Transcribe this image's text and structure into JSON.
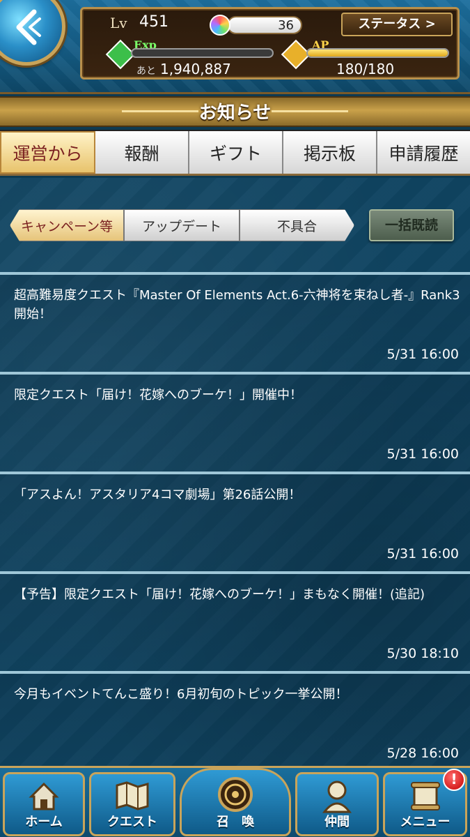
{
  "header": {
    "level_label": "Lv",
    "level": "451",
    "stones": "36",
    "status_button": "ステータス >",
    "exp_label": "Exp",
    "exp_remaining_label": "あと",
    "exp_remaining": "1,940,887",
    "exp_progress": 0.0,
    "ap_label": "AP",
    "ap_value": "180/180",
    "ap_progress": 1.0
  },
  "page": {
    "title": "お知らせ"
  },
  "main_tabs": [
    {
      "label": "運営から",
      "active": true
    },
    {
      "label": "報酬",
      "active": false
    },
    {
      "label": "ギフト",
      "active": false
    },
    {
      "label": "掲示板",
      "active": false
    },
    {
      "label": "申請履歴",
      "active": false
    }
  ],
  "sub_tabs": [
    {
      "label": "キャンペーン等",
      "active": true
    },
    {
      "label": "アップデート",
      "active": false
    },
    {
      "label": "不具合",
      "active": false
    }
  ],
  "bulk_read_label": "一括既読",
  "news": [
    {
      "title": "超高難易度クエスト『Master Of Elements Act.6-六神将を束ねし者-』Rank3開始！",
      "date": "5/31 16:00"
    },
    {
      "title": "限定クエスト「届け！花嫁へのブーケ！」開催中！",
      "date": "5/31 16:00"
    },
    {
      "title": "「アスよん！アスタリア4コマ劇場」第26話公開！",
      "date": "5/31 16:00"
    },
    {
      "title": "【予告】限定クエスト「届け！花嫁へのブーケ！」まもなく開催！(追記)",
      "date": "5/30 18:10"
    },
    {
      "title": "今月もイベントてんこ盛り！6月初旬のトピック一挙公開！",
      "date": "5/28 16:00"
    }
  ],
  "bottom_nav": {
    "home": "ホーム",
    "quest": "クエスト",
    "summon": "召　喚",
    "ally": "仲間",
    "menu": "メニュー",
    "menu_badge": "!"
  },
  "colors": {
    "accent_gold": "#c9a45a",
    "content_bg": "#0f4461",
    "active_tab_text": "#7a2020"
  }
}
